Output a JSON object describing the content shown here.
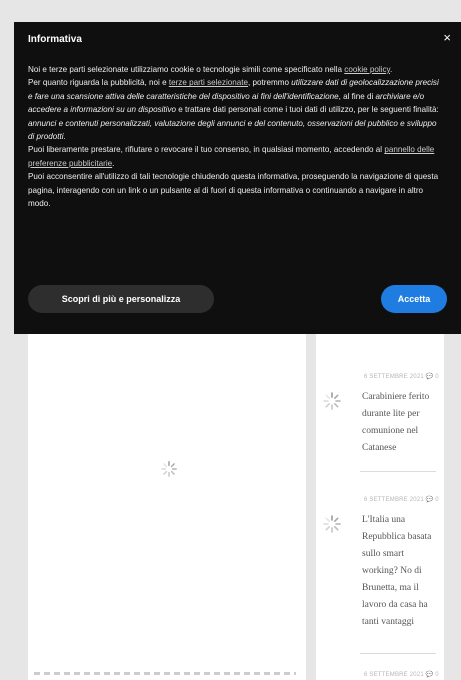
{
  "banner": {
    "title": "Informativa",
    "close": "×",
    "p1_start": "Noi e terze parti selezionate utilizziamo cookie o tecnologie simili come specificato nella ",
    "cookie_policy_link": "cookie policy",
    "p1_end": ".",
    "p2_start": "Per quanto riguarda la pubblicità, noi e ",
    "third_parties_link": "terze parti selezionate",
    "p2_a": ", potremmo ",
    "p2_italic1": "utilizzare dati di geolocalizzazione precisi e fare una scansione attiva delle caratteristiche del dispositivo ai fini dell'identificazione",
    "p2_b": ", al fine di ",
    "p2_italic2": "archiviare e/o accedere a informazioni su un dispositivo",
    "p2_c": " e trattare dati personali come i tuoi dati di utilizzo, per le seguenti finalità: ",
    "p2_italic3": "annunci e contenuti personalizzati, valutazione degli annunci e del contenuto, osservazioni del pubblico e sviluppo di prodotti",
    "p2_end": ".",
    "p3": "Puoi liberamente prestare, rifiutare o revocare il tuo consenso, in qualsiasi momento, accedendo al ",
    "ads_prefs_link": "pannello delle preferenze pubblicitarie",
    "p3_end": ".",
    "p4": "Puoi acconsentire all'utilizzo di tali tecnologie chiudendo questa informativa, proseguendo la navigazione di questa pagina, interagendo con un link o un pulsante al di fuori di questa informativa o continuando a navigare in altro modo.",
    "more_button": "Scopri di più e personalizza",
    "accept_button": "Accetta"
  },
  "sidebar_posts": [
    {
      "meta": "6 SETTEMBRE 2021  💬 0",
      "title": "Carabiniere ferito durante lite per comunione nel Catanese"
    },
    {
      "meta": "6 SETTEMBRE 2021  💬 0",
      "title": "L'Italia una Repubblica basata sullo smart working? No di Brunetta, ma il lavoro da casa ha tanti vantaggi"
    },
    {
      "meta": "6 SETTEMBRE 2021  💬 0"
    }
  ],
  "colors": {
    "banner_bg": "#0f0f0f",
    "accent": "#1f7ce0"
  }
}
